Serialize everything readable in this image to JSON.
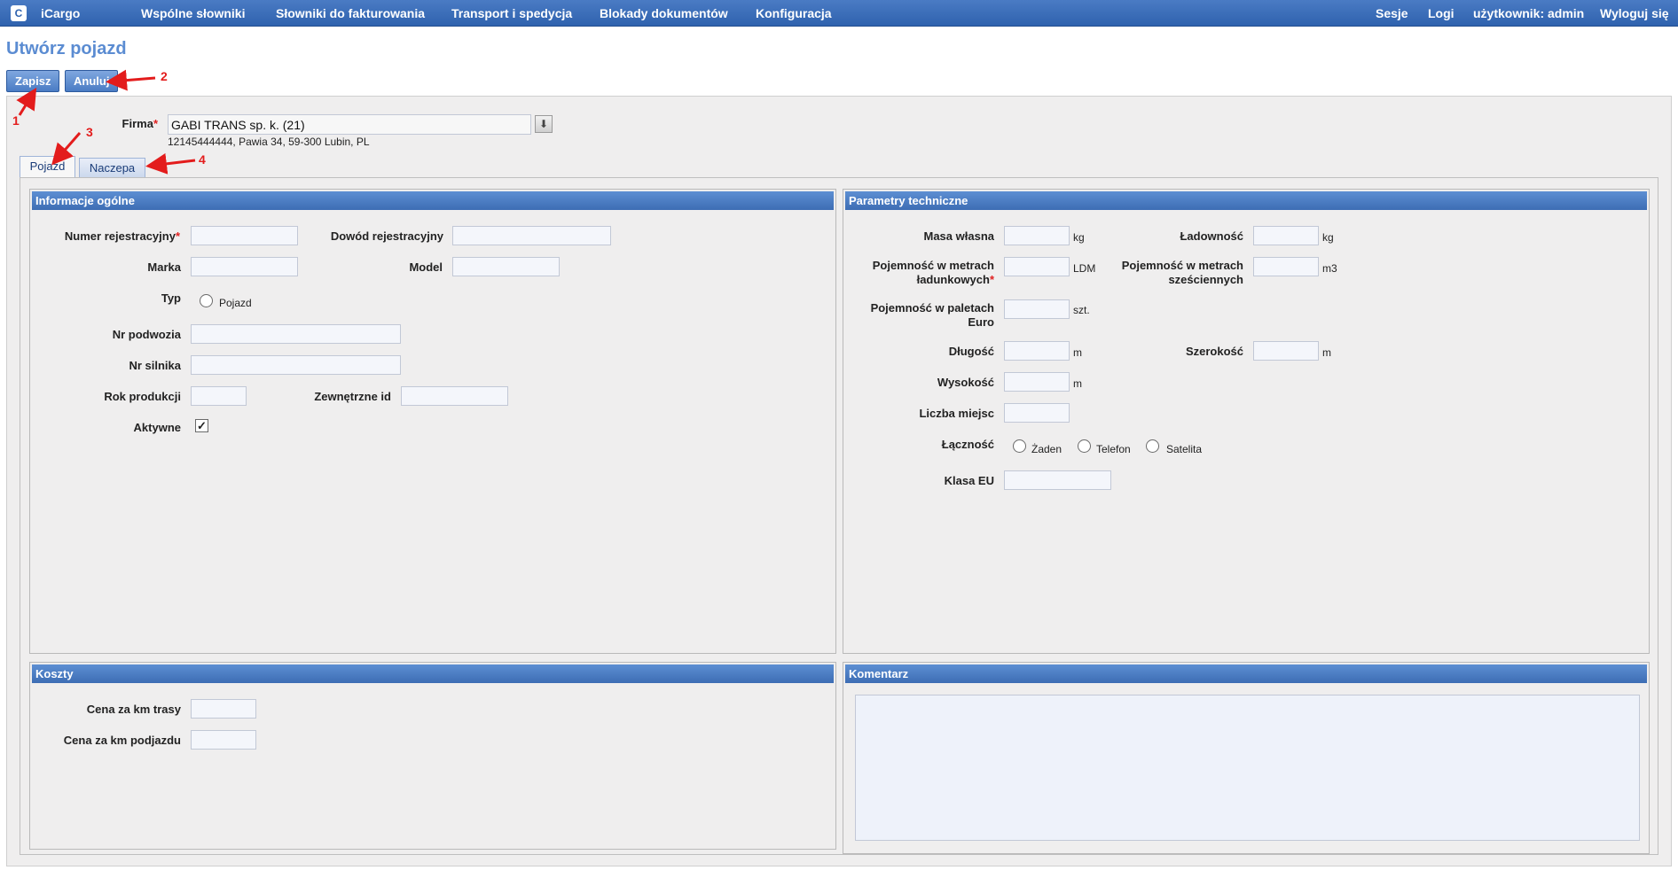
{
  "app": {
    "name": "iCargo",
    "logo_glyph": "C"
  },
  "nav": {
    "items": [
      "Wspólne słowniki",
      "Słowniki do fakturowania",
      "Transport i spedycja",
      "Blokady dokumentów",
      "Konfiguracja"
    ],
    "right": [
      "Sesje",
      "Logi",
      "użytkownik: admin",
      "Wyloguj się"
    ]
  },
  "page": {
    "title": "Utwórz pojazd"
  },
  "toolbar": {
    "save_label": "Zapisz",
    "cancel_label": "Anuluj"
  },
  "firma": {
    "label": "Firma",
    "value": "GABI TRANS sp. k. (21)",
    "address": "12145444444, Pawia 34, 59-300 Lubin, PL"
  },
  "tabs": [
    "Pojazd",
    "Naczepa"
  ],
  "general": {
    "header": "Informacje ogólne",
    "numer_rej": "Numer rejestracyjny",
    "dowod_rej": "Dowód rejestracyjny",
    "marka": "Marka",
    "model": "Model",
    "typ": "Typ",
    "typ_option": "Pojazd",
    "nr_podwozia": "Nr podwozia",
    "nr_silnika": "Nr silnika",
    "rok_produkcji": "Rok produkcji",
    "zewnetrzne_id": "Zewnętrzne id",
    "aktywne": "Aktywne",
    "aktywne_checked": true
  },
  "tech": {
    "header": "Parametry techniczne",
    "masa_wlasna": "Masa własna",
    "masa_unit": "kg",
    "ladownosc": "Ładowność",
    "ladownosc_unit": "kg",
    "poj_ldm_1": "Pojemność w metrach",
    "poj_ldm_2": "ładunkowych",
    "poj_ldm_unit": "LDM",
    "poj_m3_1": "Pojemność w metrach",
    "poj_m3_2": "sześciennych",
    "poj_m3_unit": "m3",
    "poj_pal_1": "Pojemność w paletach",
    "poj_pal_2": "Euro",
    "poj_pal_unit": "szt.",
    "dlugosc": "Długość",
    "dlugosc_unit": "m",
    "szerokosc": "Szerokość",
    "szerokosc_unit": "m",
    "wysokosc": "Wysokość",
    "wysokosc_unit": "m",
    "liczba_miejsc": "Liczba miejsc",
    "lacznosc": "Łączność",
    "lacznosc_options": [
      "Żaden",
      "Telefon",
      "Satelita"
    ],
    "klasa_eu": "Klasa EU"
  },
  "costs": {
    "header": "Koszty",
    "cena_trasy": "Cena za km trasy",
    "cena_podjazdu": "Cena za km podjazdu"
  },
  "comment": {
    "header": "Komentarz"
  },
  "annotations": [
    "1",
    "2",
    "3",
    "4"
  ],
  "colors": {
    "nav": "#3a6cb8",
    "accent": "#5b8cd2",
    "annotation": "#e31c1c",
    "required": "#e02020"
  }
}
